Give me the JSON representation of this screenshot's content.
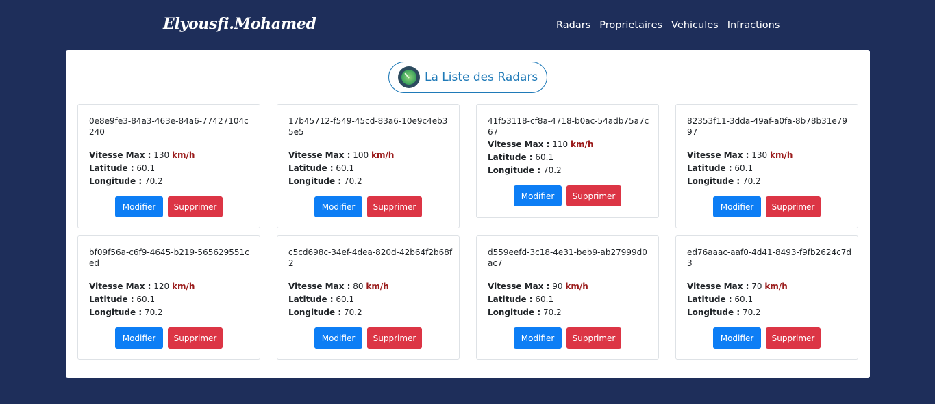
{
  "nav": {
    "brand": "Elyousfi.Mohamed",
    "links": [
      "Radars",
      "Proprietaires",
      "Vehicules",
      "Infractions"
    ]
  },
  "title": "La Liste des Radars",
  "labels": {
    "vitesse": "Vitesse Max :",
    "latitude": "Latitude :",
    "longitude": "Longitude :",
    "unit": "km/h",
    "modifier": "Modifier",
    "supprimer": "Supprimer"
  },
  "radars": [
    {
      "id": "0e8e9fe3-84a3-463e-84a6-77427104c240",
      "vitesse": "130",
      "latitude": "60.1",
      "longitude": "70.2"
    },
    {
      "id": "17b45712-f549-45cd-83a6-10e9c4eb35e5",
      "vitesse": "100",
      "latitude": "60.1",
      "longitude": "70.2"
    },
    {
      "id": "41f53118-cf8a-4718-b0ac-54adb75a7c67",
      "vitesse": "110",
      "latitude": "60.1",
      "longitude": "70.2"
    },
    {
      "id": "82353f11-3dda-49af-a0fa-8b78b31e7997",
      "vitesse": "130",
      "latitude": "60.1",
      "longitude": "70.2"
    },
    {
      "id": "bf09f56a-c6f9-4645-b219-565629551ced",
      "vitesse": "120",
      "latitude": "60.1",
      "longitude": "70.2"
    },
    {
      "id": "c5cd698c-34ef-4dea-820d-42b64f2b68f2",
      "vitesse": "80",
      "latitude": "60.1",
      "longitude": "70.2"
    },
    {
      "id": "d559eefd-3c18-4e31-beb9-ab27999d0ac7",
      "vitesse": "90",
      "latitude": "60.1",
      "longitude": "70.2"
    },
    {
      "id": "ed76aaac-aaf0-4d41-8493-f9fb2624c7d3",
      "vitesse": "70",
      "latitude": "60.1",
      "longitude": "70.2"
    }
  ]
}
